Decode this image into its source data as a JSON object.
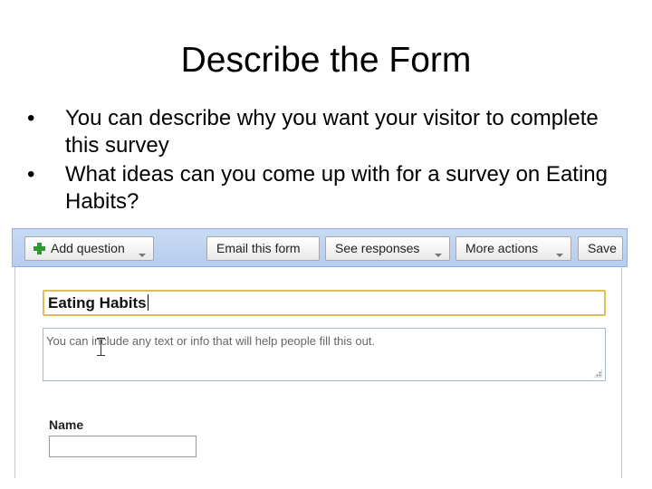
{
  "slide": {
    "title": "Describe the Form",
    "bullets": [
      "You can describe why you want your visitor to complete this survey",
      "What ideas can you come up with for a survey on Eating Habits?"
    ]
  },
  "toolbar": {
    "add_question": "Add question",
    "email_form": "Email this form",
    "see_responses": "See responses",
    "more_actions": "More actions",
    "save": "Save"
  },
  "form": {
    "title_value": "Eating Habits",
    "description_placeholder": "You can include any text or info that will help people fill this out.",
    "name_label": "Name",
    "name_value": ""
  },
  "colors": {
    "toolbar_bg": "#c8daf3",
    "title_focus_border": "#e0bd5a",
    "plus_icon": "#2d9a2d"
  }
}
